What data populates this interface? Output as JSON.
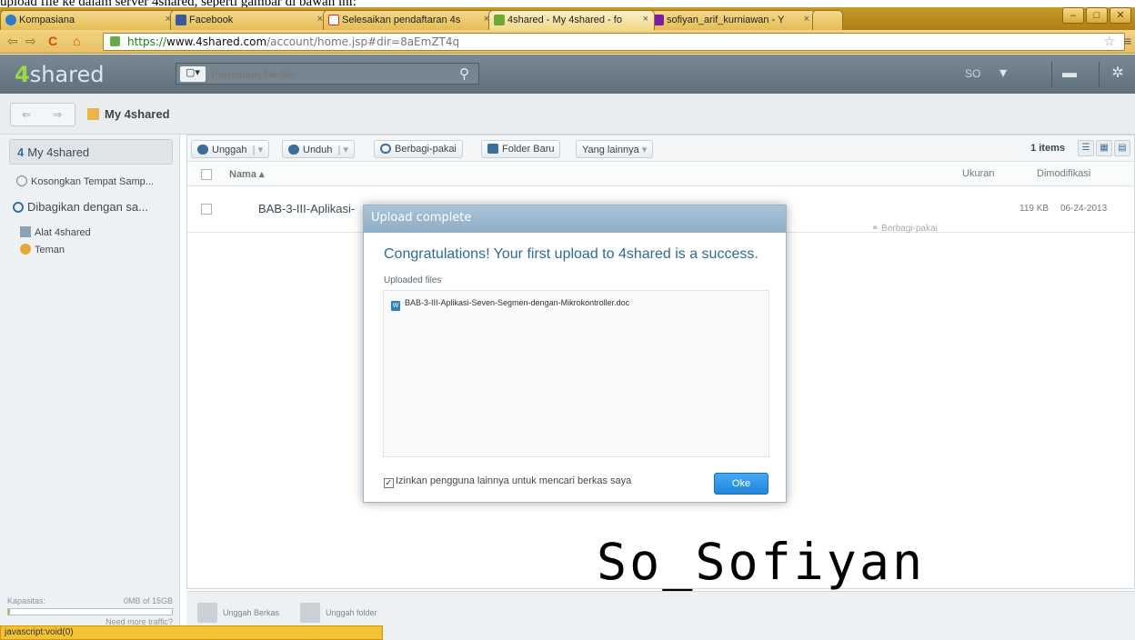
{
  "page_caption": "upload file ke dalam server 4shared, seperti gambar di bawah ini:",
  "browser": {
    "tabs": [
      {
        "label": "Kompasiana",
        "icon": "kompasiana-icon",
        "color": "#2f7cc8"
      },
      {
        "label": "Facebook",
        "icon": "facebook-icon",
        "color": "#3b5998"
      },
      {
        "label": "Selesaikan pendaftaran 4s",
        "icon": "gmail-icon",
        "color": "#d93025"
      },
      {
        "label": "4shared - My 4shared - fo",
        "icon": "4shared-icon",
        "color": "#6fa832"
      },
      {
        "label": "sofiyan_arif_kurniawan - Y",
        "icon": "mail-icon",
        "color": "#7b1fa2"
      }
    ],
    "url_scheme": "https://",
    "url_host": "www.4shared.com",
    "url_path": "/account/home.jsp#dir=8aEmZT4q"
  },
  "header": {
    "logo_num": "4",
    "logo_text": "shared",
    "search_placeholder": "Pencarian file-file",
    "user": "SO"
  },
  "crumb": {
    "title": "My 4shared"
  },
  "sidebar": {
    "my": "My 4shared",
    "items": [
      {
        "label": "Kosongkan Tempat Samp..."
      },
      {
        "label": "Dibagikan dengan sa..."
      },
      {
        "label": "Alat 4shared"
      },
      {
        "label": "Teman"
      }
    ],
    "quota_label": "Kapasitas:",
    "quota_value": "0MB of 15GB",
    "quota_fraction": 0.01,
    "more": "Need more traffic?"
  },
  "actions": {
    "upload": "Unggah",
    "download": "Unduh",
    "share": "Berbagi-pakai",
    "new_folder": "Folder Baru",
    "more": "Yang lainnya",
    "items_count": "1 items"
  },
  "table": {
    "col_name": "Nama",
    "col_size": "Ukuran",
    "col_modified": "Dimodifikasi",
    "row": {
      "name": "BAB-3-III-Aplikasi-",
      "size": "119 KB",
      "modified": "06-24-2013",
      "share": "Berbagi-pakai"
    }
  },
  "dialog": {
    "title": "Upload complete",
    "message": "Congratulations! Your first upload to 4shared is a success.",
    "uploaded_label": "Uploaded files",
    "file": "BAB-3-III-Aplikasi-Seven-Segmen-dengan-Mikrokontroller.doc",
    "checkbox_label": "Izinkan pengguna lainnya untuk mencari berkas saya",
    "ok": "Oke"
  },
  "footer": {
    "upload_files": "Unggah Berkas",
    "upload_folder": "Unggah folder"
  },
  "status": "javascript:void(0)",
  "watermark": "So_Sofiyan"
}
